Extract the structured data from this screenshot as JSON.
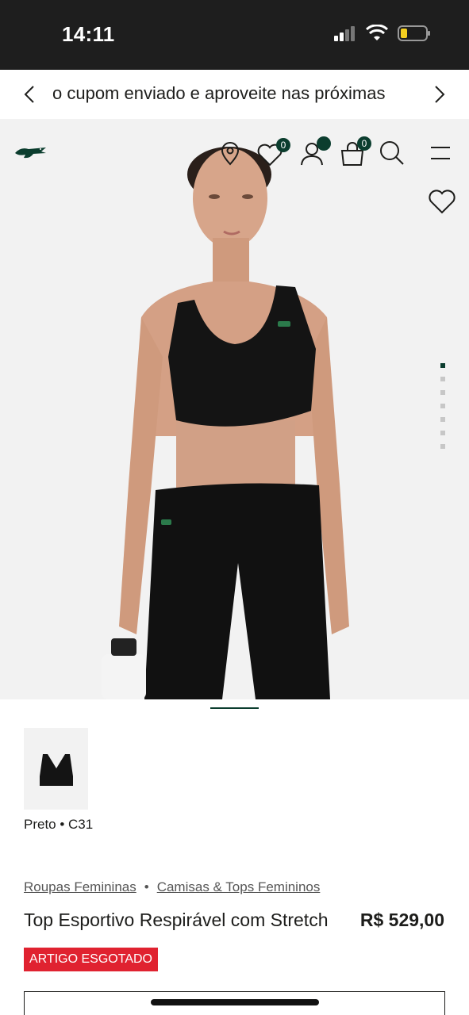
{
  "status": {
    "time": "14:11"
  },
  "promo": {
    "text": "o cupom enviado e aproveite nas próximas"
  },
  "header": {
    "wishlist_count": "0",
    "cart_count": "0"
  },
  "product": {
    "color_label": "Preto • C31",
    "breadcrumb": [
      "Roupas Femininas",
      "•",
      "Camisas & Tops Femininos"
    ],
    "title": "Top Esportivo Respirável com Stretch",
    "price": "R$ 529,00",
    "status_badge": "ARTIGO ESGOTADO"
  },
  "colors": {
    "brand_green": "#0b3d2e",
    "soldout_red": "#e02230"
  },
  "icons": [
    "back-chevron-icon",
    "forward-chevron-icon",
    "crocodile-logo",
    "location-icon",
    "heart-icon",
    "user-icon",
    "bag-icon",
    "search-icon",
    "menu-icon"
  ]
}
